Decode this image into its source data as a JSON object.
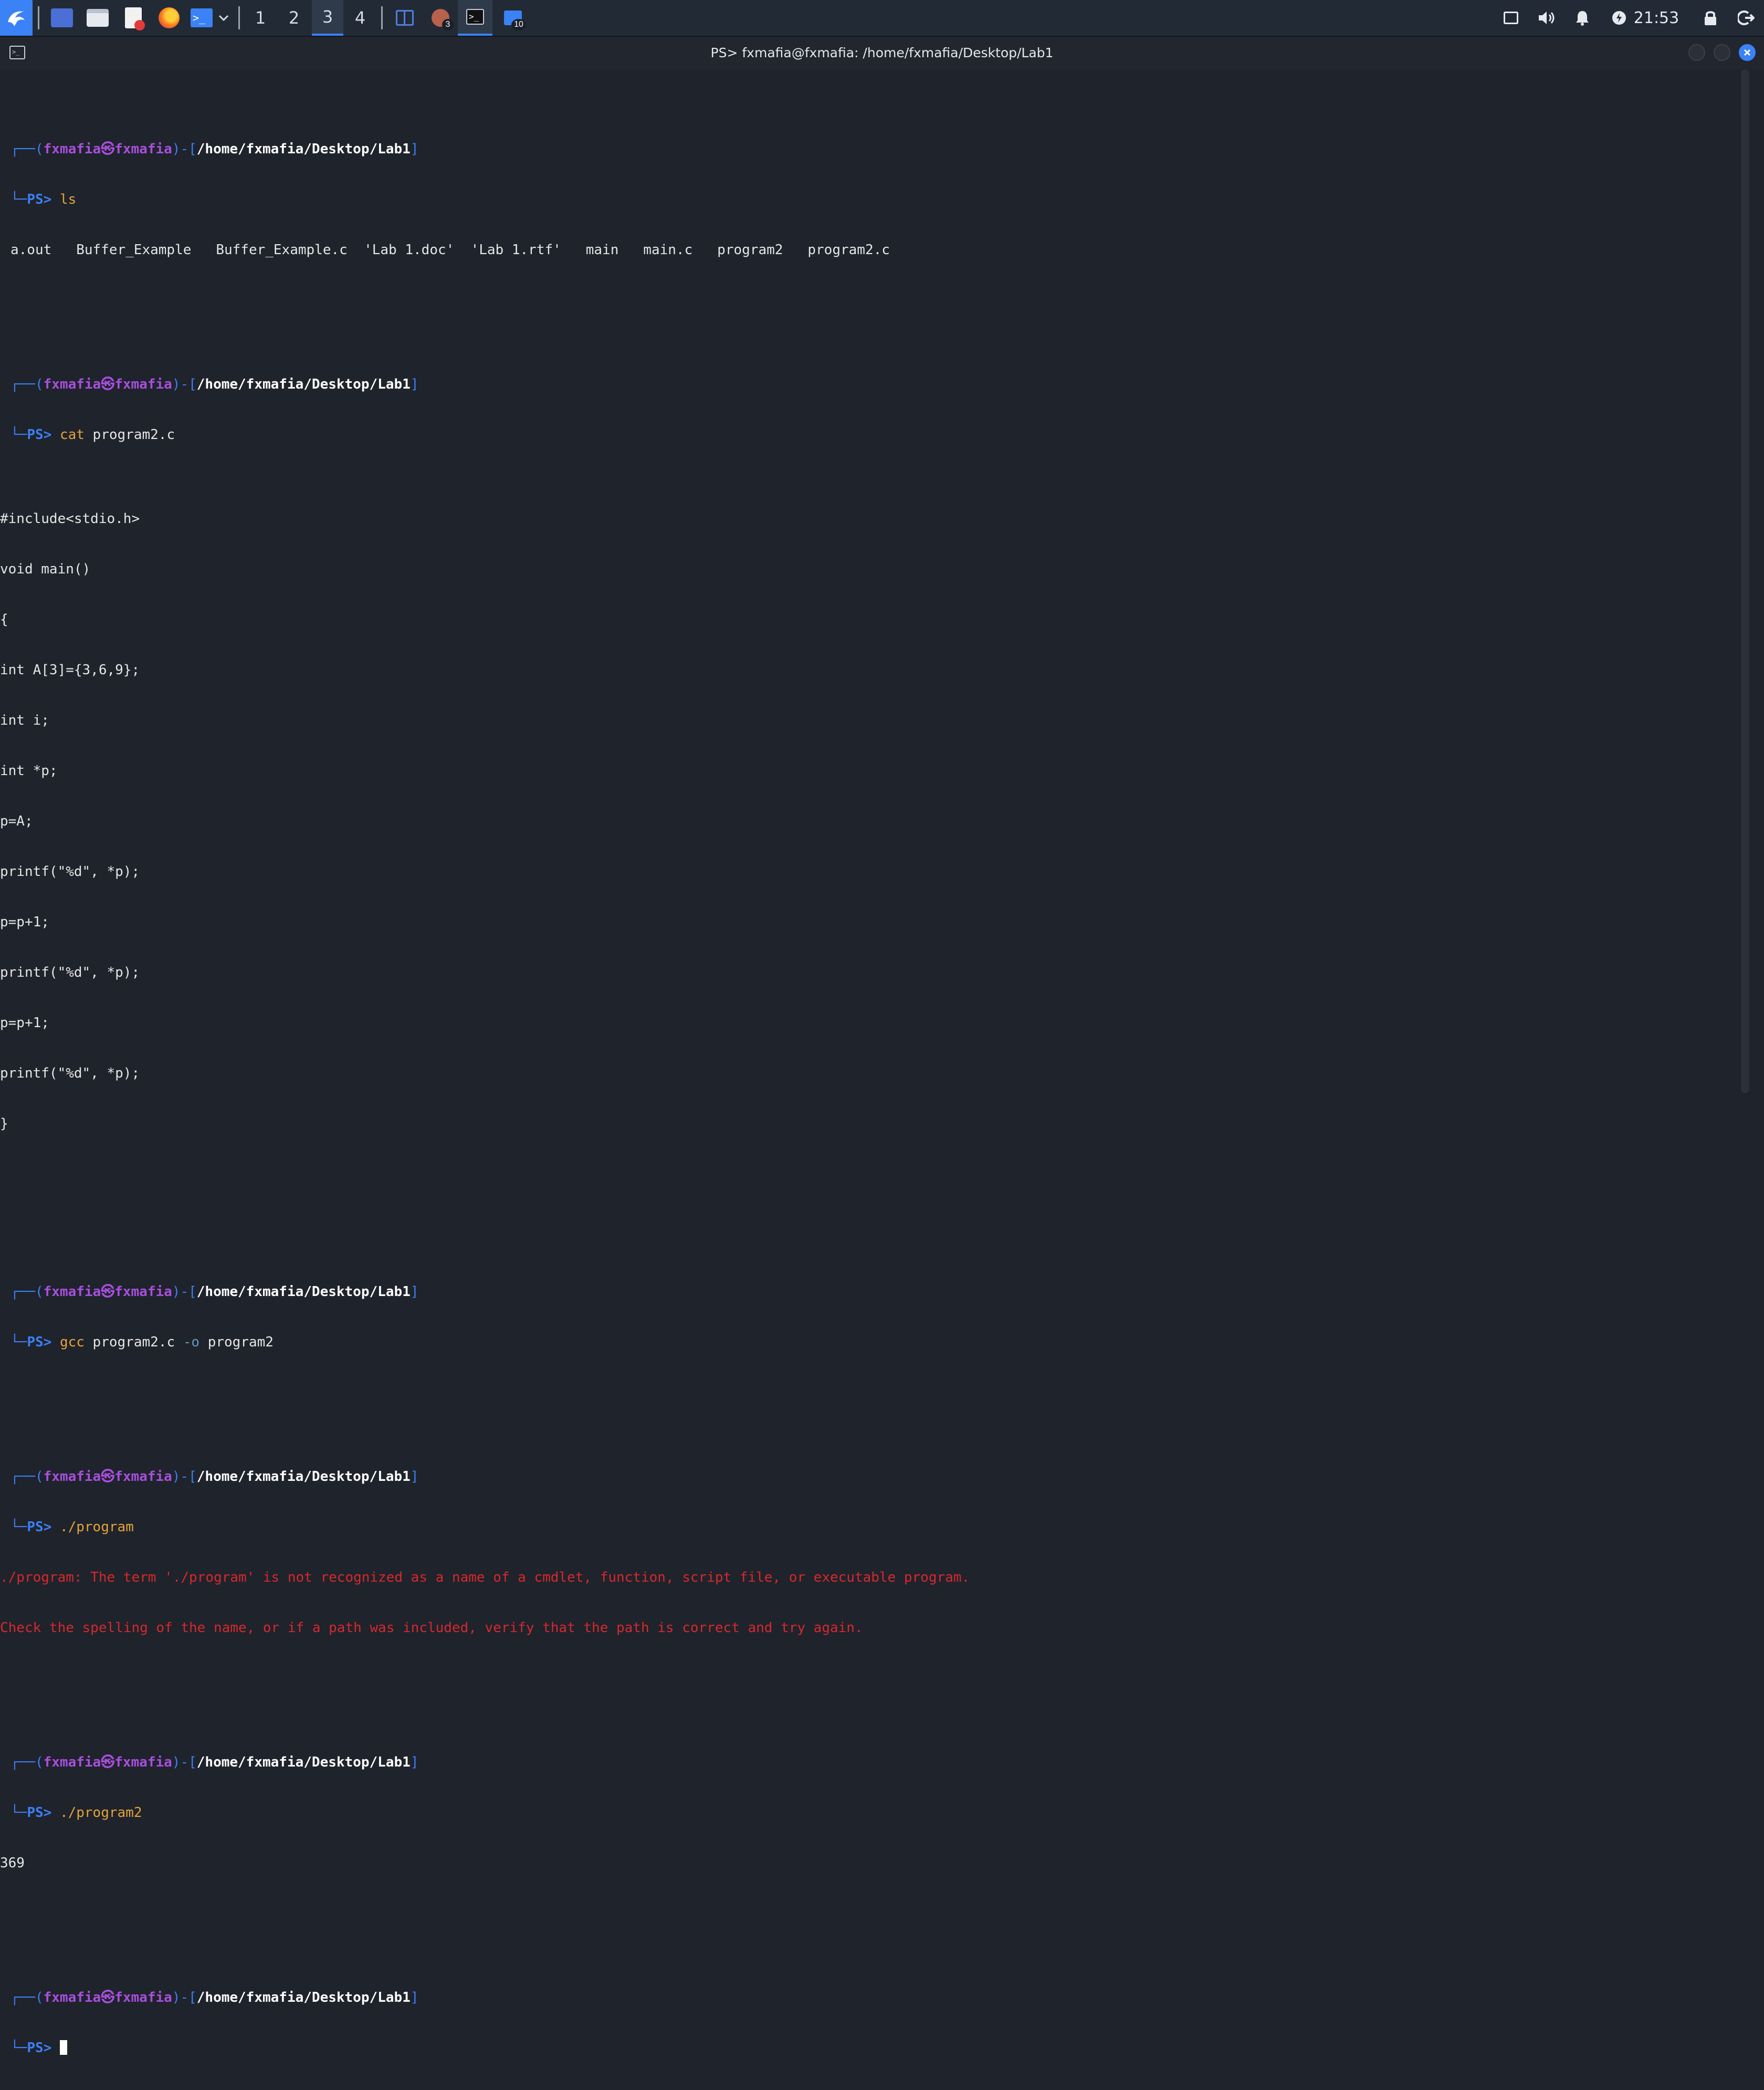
{
  "taskbar": {
    "workspaces": [
      "1",
      "2",
      "3",
      "4"
    ],
    "active_workspace": "3",
    "task_badge_1": "3",
    "task_badge_2": "10",
    "clock": "21:53"
  },
  "window": {
    "title": "PS> fxmafia@fxmafia: /home/fxmafia/Desktop/Lab1"
  },
  "prompt": {
    "open": "┌──(",
    "user": "fxmafia",
    "at": "㉿",
    "host": "fxmafia",
    "mid": ")-[",
    "path": "/home/fxmafia/Desktop/Lab1",
    "close": "]",
    "corner": "└─",
    "ps": "PS>"
  },
  "session": {
    "cmd1": "ls",
    "ls_output": "a.out   Buffer_Example   Buffer_Example.c  'Lab 1.doc'  'Lab 1.rtf'   main   main.c   program2   program2.c",
    "cmd2": "cat",
    "cmd2_arg": " program2.c",
    "code": [
      "#include<stdio.h>",
      "void main()",
      "{",
      "int A[3]={3,6,9};",
      "int i;",
      "int *p;",
      "p=A;",
      "printf(\"%d\", *p);",
      "p=p+1;",
      "printf(\"%d\", *p);",
      "p=p+1;",
      "printf(\"%d\", *p);",
      "}"
    ],
    "cmd3": "gcc",
    "cmd3_arg1": " program2.c ",
    "cmd3_flag": "-o",
    "cmd3_arg2": " program2",
    "cmd4": "./program",
    "error_line1": "./program: The term './program' is not recognized as a name of a cmdlet, function, script file, or executable program.",
    "error_line2": "Check the spelling of the name, or if a path was included, verify that the path is correct and try again.",
    "cmd5": "./program2",
    "output5": "369"
  },
  "colors": {
    "accent": "#3b82f6",
    "prompt_user": "#a74fdd",
    "command": "#e5a33a",
    "error": "#d8282e"
  }
}
